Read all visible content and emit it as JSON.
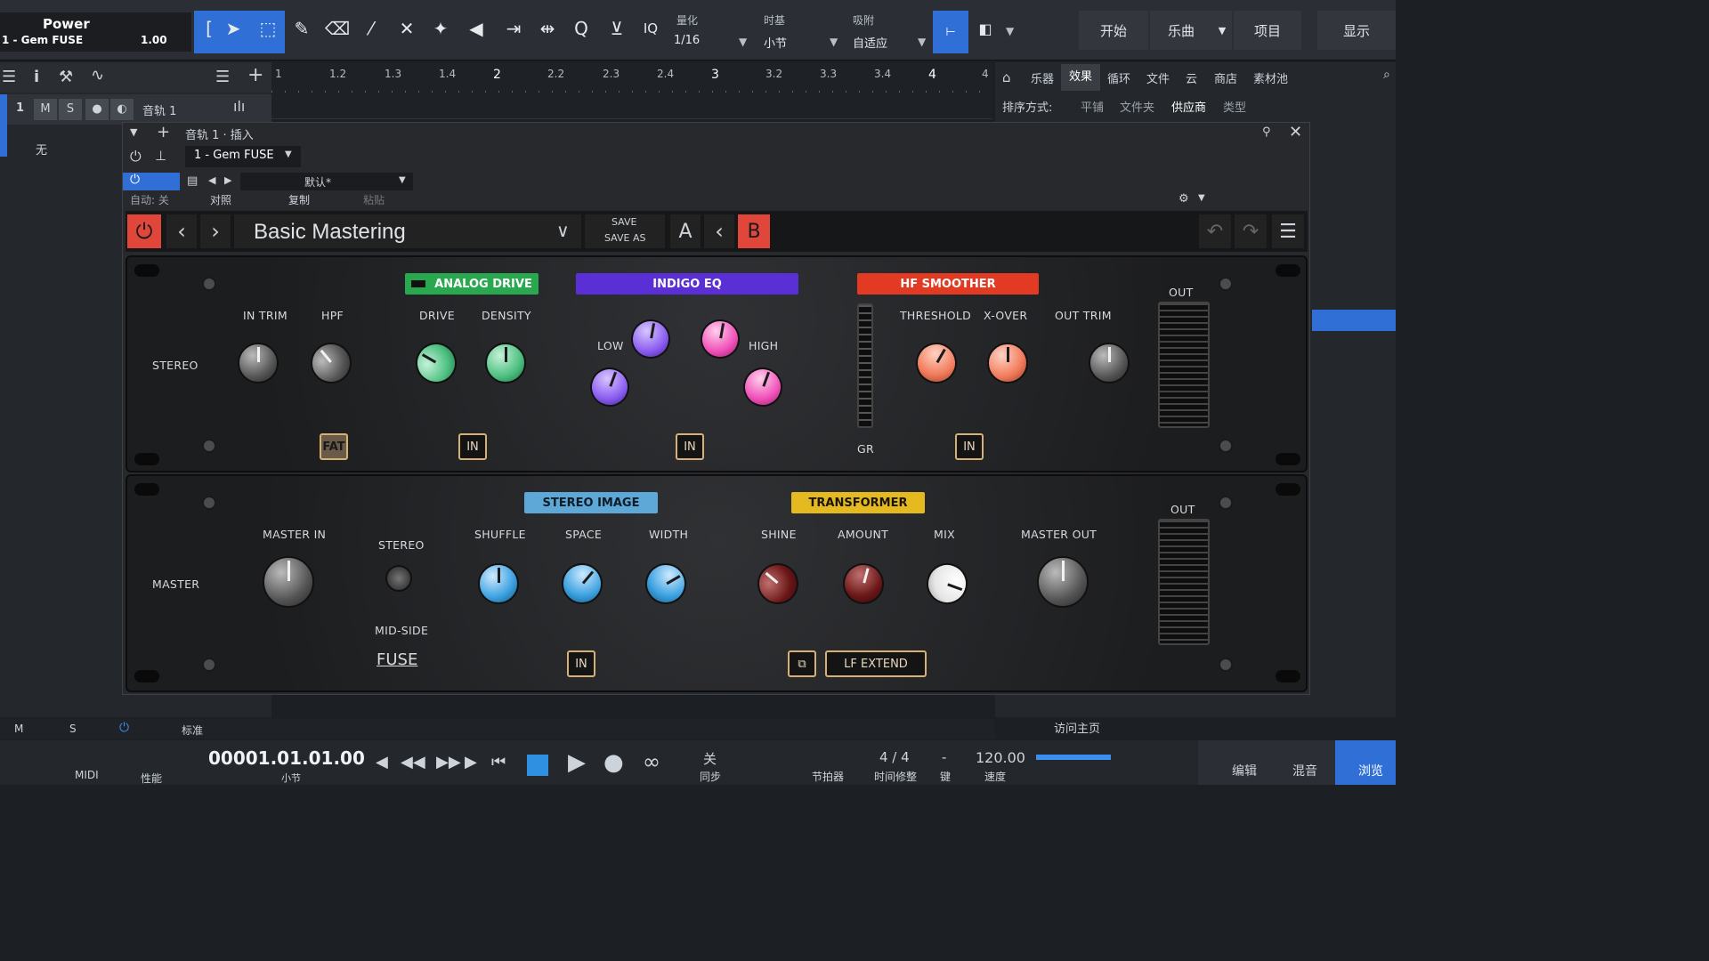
{
  "toolbar": {
    "track_title": "Power",
    "track_sub": "1 - Gem FUSE",
    "volume": "1.00",
    "iq": "IQ",
    "quantize_label": "量化",
    "quantize_value": "1/16",
    "timebase_label": "时基",
    "timebase_value": "小节",
    "snap_label": "吸附",
    "snap_value": "自适应",
    "start": "开始",
    "song": "乐曲",
    "project": "项目",
    "show": "显示"
  },
  "ruler": {
    "ticks": [
      "1",
      "1.2",
      "1.3",
      "1.4",
      "2",
      "2.2",
      "2.3",
      "2.4",
      "3",
      "3.2",
      "3.3",
      "3.4",
      "4",
      "4"
    ]
  },
  "track": {
    "num": "1",
    "m": "M",
    "s": "S",
    "name": "音轨 1",
    "input": "无"
  },
  "browser": {
    "tabs": [
      "乐器",
      "效果",
      "循环",
      "文件",
      "云",
      "商店",
      "素材池"
    ],
    "sort_label": "排序方式:",
    "sort_opts": [
      "平铺",
      "文件夹",
      "供应商",
      "类型"
    ],
    "home": "访问主页"
  },
  "insert": {
    "header": "音轨 1 · 插入",
    "device": "1 - Gem FUSE",
    "auto": "自动: 关",
    "preset_default": "默认*",
    "compare": "对照",
    "copy": "复制",
    "paste": "粘贴"
  },
  "plugin": {
    "preset": "Basic Mastering",
    "save": "SAVE",
    "save_as": "SAVE AS",
    "a": "A",
    "b": "B",
    "stereo": "STEREO",
    "master": "MASTER",
    "in_trim": "IN TRIM",
    "hpf": "HPF",
    "analog_drive": "ANALOG DRIVE",
    "drive": "DRIVE",
    "density": "DENSITY",
    "indigo_eq": "INDIGO EQ",
    "low": "LOW",
    "high": "HIGH",
    "hf_smoother": "HF SMOOTHER",
    "threshold": "THRESHOLD",
    "xover": "X-OVER",
    "out_trim": "OUT TRIM",
    "out": "OUT",
    "gr": "GR",
    "fat": "FAT",
    "in": "IN",
    "master_in": "MASTER IN",
    "stereo_sw": "STEREO",
    "mid_side": "MID-SIDE",
    "fuse": "FUSE",
    "stereo_image": "STEREO IMAGE",
    "shuffle": "SHUFFLE",
    "space": "SPACE",
    "width": "WIDTH",
    "transformer": "TRANSFORMER",
    "shine": "SHINE",
    "amount": "AMOUNT",
    "mix": "MIX",
    "master_out": "MASTER OUT",
    "lf_extend": "LF EXTEND"
  },
  "transport": {
    "time": "00001.01.01.00",
    "time_unit": "小节",
    "midi": "MIDI",
    "perf": "性能",
    "sync_off": "关",
    "sync": "同步",
    "metronome": "节拍器",
    "timesig": "4 / 4",
    "timesig_label": "时间修整",
    "key": "-",
    "key_label": "键",
    "tempo": "120.00",
    "tempo_label": "速度",
    "edit": "编辑",
    "mix": "混音",
    "browse": "浏览",
    "std": "标准",
    "m": "M",
    "s": "S"
  }
}
